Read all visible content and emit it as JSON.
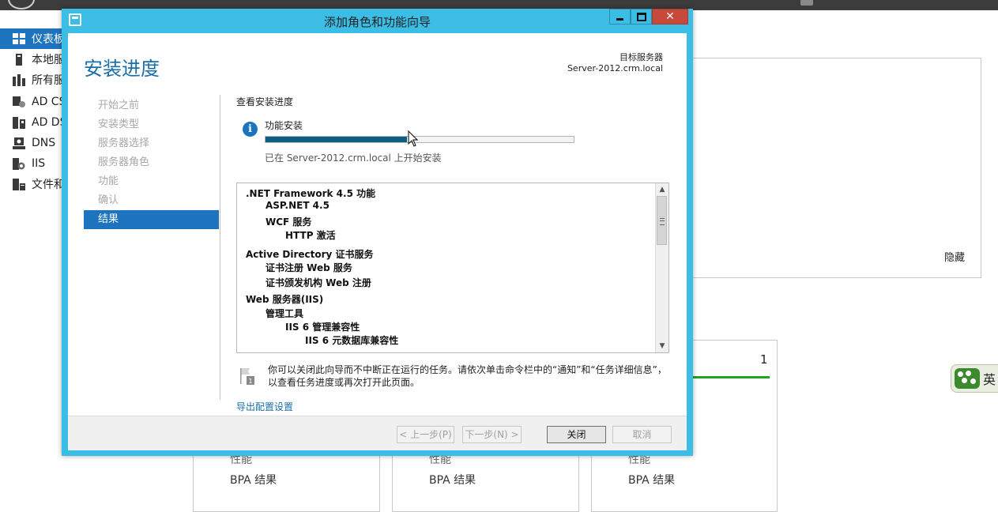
{
  "background": {
    "sidebar": {
      "items": [
        {
          "label": "仪表板",
          "icon": "dashboard-icon",
          "active": true
        },
        {
          "label": "本地服务器",
          "icon": "local-server-icon"
        },
        {
          "label": "所有服务器",
          "icon": "all-servers-icon"
        },
        {
          "label": "AD CS",
          "icon": "ad-cs-icon"
        },
        {
          "label": "AD DS",
          "icon": "ad-ds-icon"
        },
        {
          "label": "DNS",
          "icon": "dns-icon"
        },
        {
          "label": "IIS",
          "icon": "iis-icon"
        },
        {
          "label": "文件和存储服务",
          "icon": "file-storage-icon"
        }
      ]
    },
    "welcome_panel": {
      "hide_label": "隐藏"
    },
    "tiles": [
      {
        "partial_row": "性能",
        "bpa_label": "BPA 结果"
      },
      {
        "partial_row": "性能",
        "bpa_label": "BPA 结果"
      },
      {
        "partial_row": "性能",
        "bpa_label": "BPA 结果",
        "count": "1"
      }
    ],
    "edge_widget": {
      "text": "英"
    }
  },
  "wizard": {
    "title": "添加角色和功能向导",
    "page_title": "安装进度",
    "target_server": {
      "label": "目标服务器",
      "name": "Server-2012.crm.local"
    },
    "steps": [
      {
        "label": "开始之前",
        "active": false
      },
      {
        "label": "安装类型",
        "active": false
      },
      {
        "label": "服务器选择",
        "active": false
      },
      {
        "label": "服务器角色",
        "active": false
      },
      {
        "label": "功能",
        "active": false
      },
      {
        "label": "确认",
        "active": false
      },
      {
        "label": "结果",
        "active": true
      }
    ],
    "view_progress_label": "查看安装进度",
    "feature_install_label": "功能安装",
    "progress_fraction": 0.46,
    "install_status": "已在 Server-2012.crm.local 上开始安装",
    "features": [
      {
        "text": ".NET Framework 4.5 功能",
        "level": 0
      },
      {
        "text": "ASP.NET 4.5",
        "level": 1
      },
      {
        "text": "WCF 服务",
        "level": 1
      },
      {
        "text": "HTTP 激活",
        "level": 2
      },
      {
        "text": "Active Directory 证书服务",
        "level": 0
      },
      {
        "text": "证书注册 Web 服务",
        "level": 1
      },
      {
        "text": "证书颁发机构 Web 注册",
        "level": 1
      },
      {
        "text": "Web 服务器(IIS)",
        "level": 0
      },
      {
        "text": "管理工具",
        "level": 1
      },
      {
        "text": "IIS 6 管理兼容性",
        "level": 2
      },
      {
        "text": "IIS 6 元数据库兼容性",
        "level": 3
      }
    ],
    "note": "你可以关闭此向导而不中断正在运行的任务。请依次单击命令栏中的“通知”和“任务详细信息”，以查看任务进度或再次打开此页面。",
    "export_link": "导出配置设置",
    "buttons": {
      "previous": "< 上一步(P)",
      "next": "下一步(N) >",
      "close": "关闭",
      "cancel": "取消"
    }
  },
  "colors": {
    "window_frame": "#3bbde6",
    "accent": "#1e73be",
    "progress": "#0b5e86",
    "close_button": "#c7493b"
  }
}
